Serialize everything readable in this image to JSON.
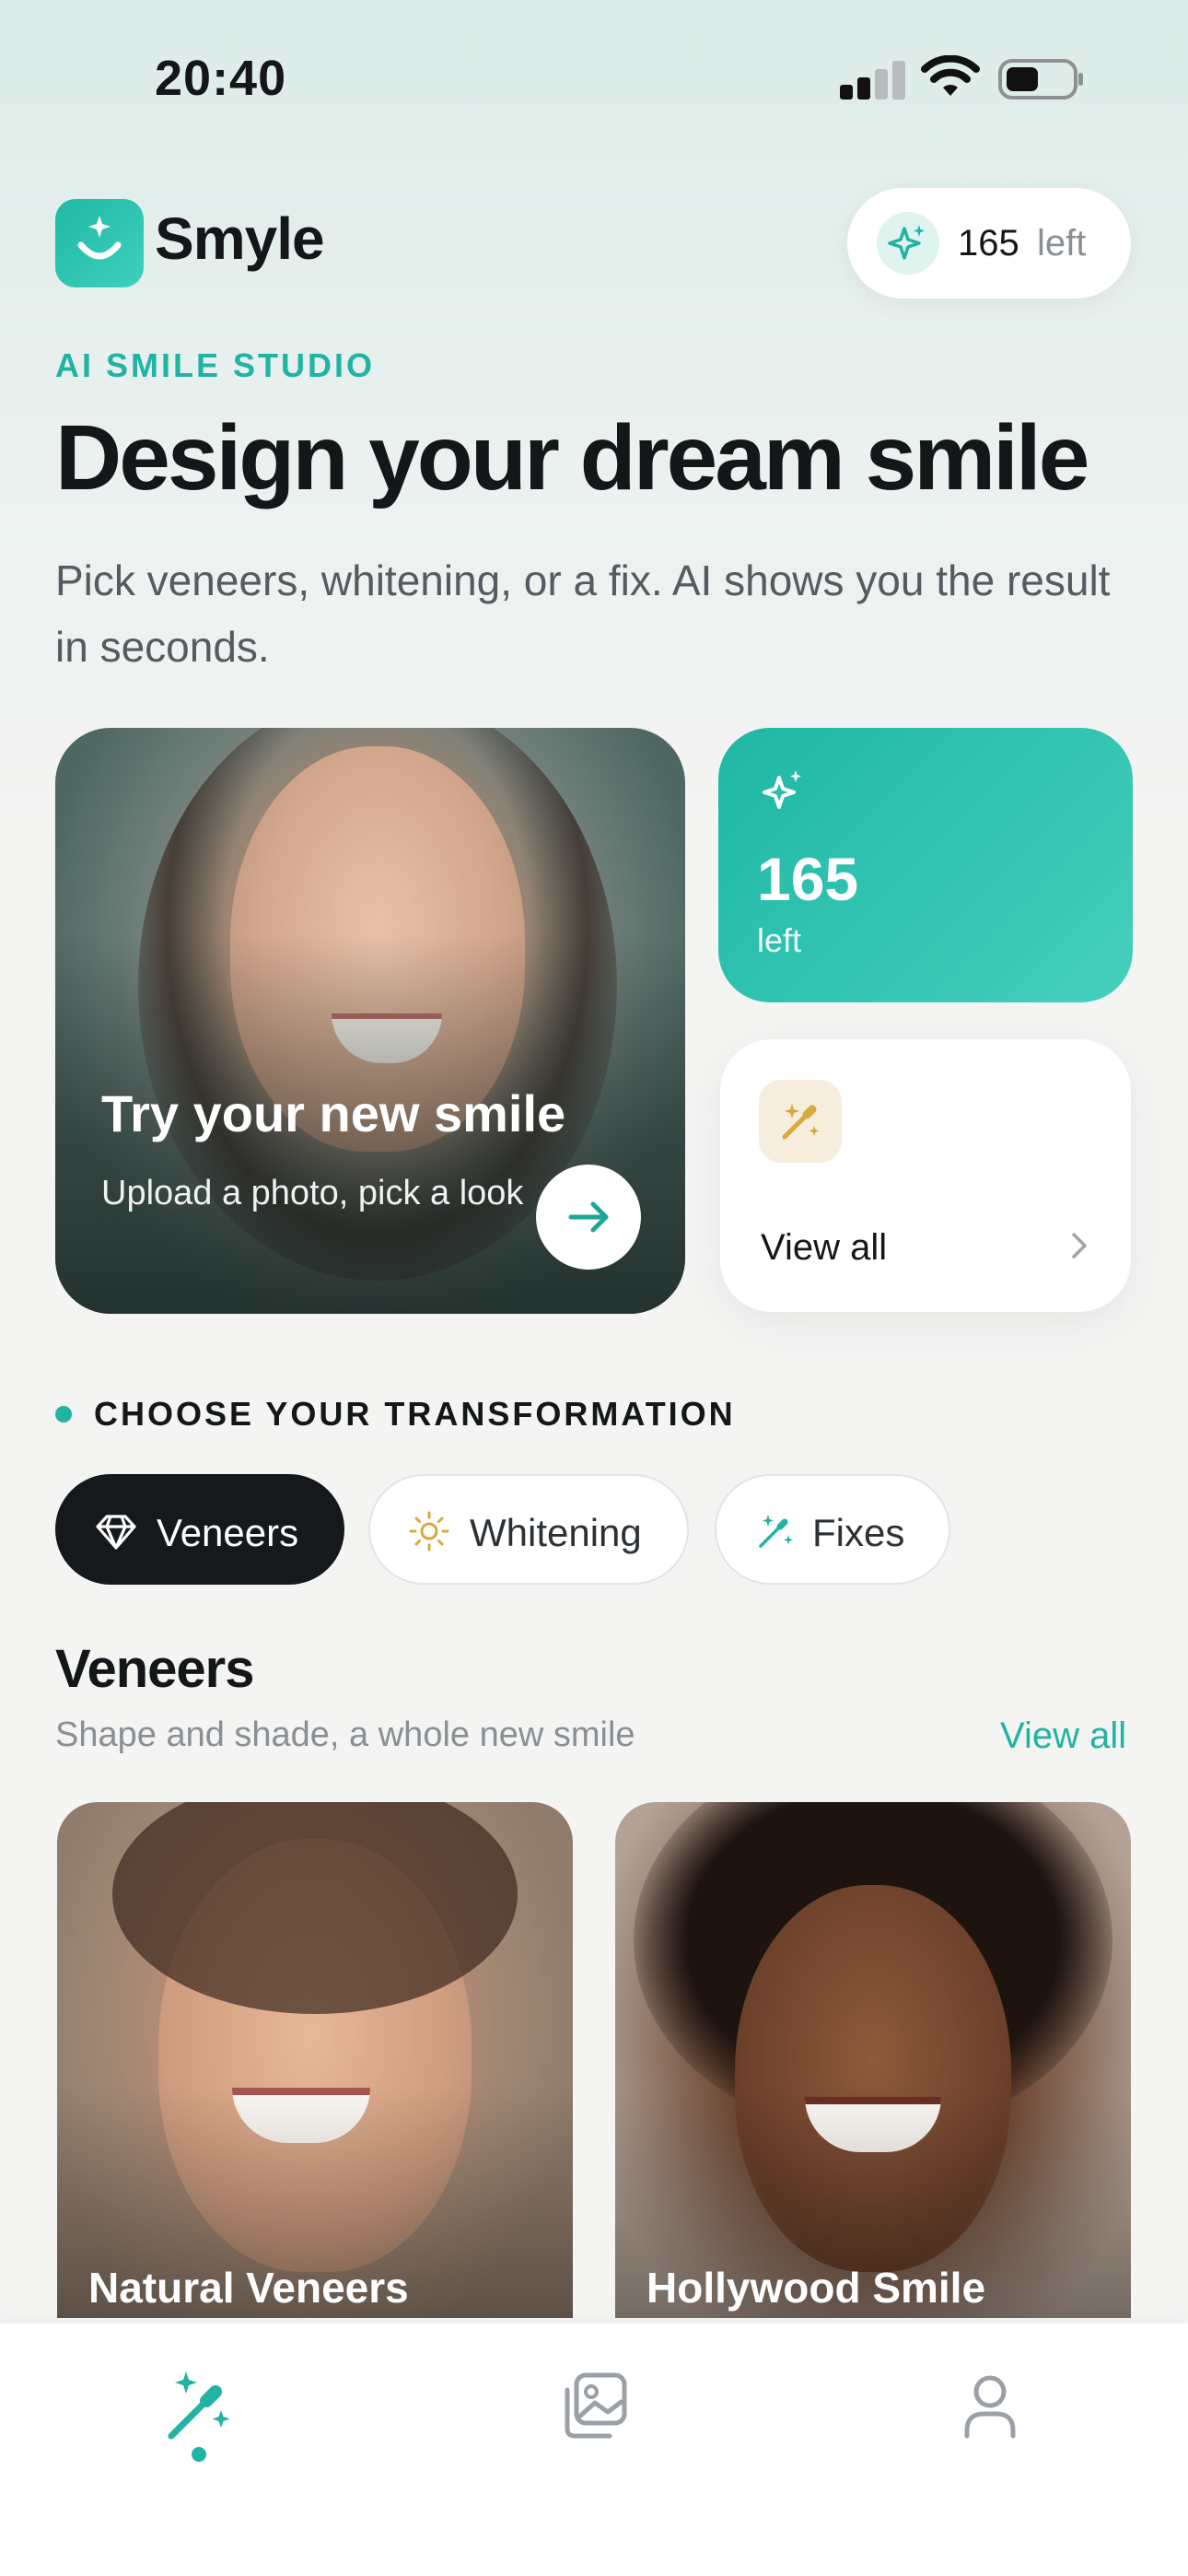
{
  "status_bar": {
    "time": "20:40"
  },
  "header": {
    "brand": "Smyle",
    "credits_count": "165",
    "credits_suffix": "left"
  },
  "hero": {
    "eyebrow": "AI SMILE STUDIO",
    "title": "Design your dream smile",
    "subtitle": "Pick veneers, whitening, or a fix. AI shows you the result in seconds."
  },
  "feature_card": {
    "title": "Try your new smile",
    "subtitle": "Upload a photo, pick a look"
  },
  "stat_card": {
    "value": "165",
    "label": "left"
  },
  "view_all_card": {
    "label": "View all"
  },
  "section": {
    "label": "CHOOSE YOUR TRANSFORMATION"
  },
  "chips": [
    {
      "label": "Veneers",
      "icon": "diamond-icon",
      "active": true
    },
    {
      "label": "Whitening",
      "icon": "sun-icon",
      "active": false
    },
    {
      "label": "Fixes",
      "icon": "magic-wand-icon",
      "active": false
    }
  ],
  "category": {
    "title": "Veneers",
    "subtitle": "Shape and shade, a whole new smile",
    "view_all": "View all"
  },
  "products": [
    {
      "label": "Natural Veneers"
    },
    {
      "label": "Hollywood Smile"
    }
  ],
  "tab_bar": {
    "tabs": [
      {
        "icon": "magic-wand-icon",
        "active": true
      },
      {
        "icon": "gallery-icon",
        "active": false
      },
      {
        "icon": "profile-icon",
        "active": false
      }
    ]
  },
  "colors": {
    "accent": "#21b3a3",
    "dark_chip": "#16191c",
    "text": "#14171a"
  }
}
